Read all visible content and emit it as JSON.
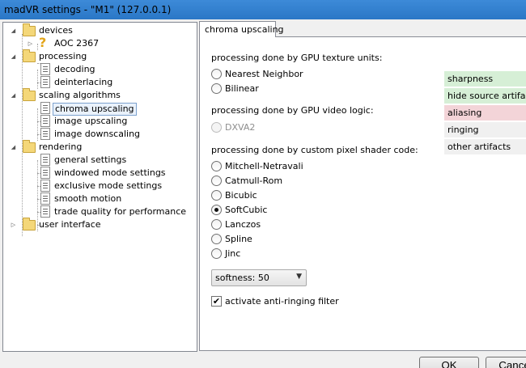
{
  "window": {
    "title": "madVR settings - \"M1\" (127.0.0.1)"
  },
  "tree": {
    "devices": "devices",
    "aoc": "AOC 2367",
    "processing": "processing",
    "decoding": "decoding",
    "deinterlacing": "deinterlacing",
    "scaling": "scaling algorithms",
    "chroma": "chroma upscaling",
    "image_up": "image upscaling",
    "image_down": "image downscaling",
    "rendering": "rendering",
    "general": "general settings",
    "windowed": "windowed mode settings",
    "exclusive": "exclusive mode settings",
    "smooth": "smooth motion",
    "trade": "trade quality for performance",
    "ui": "user interface"
  },
  "tab": {
    "label": "chroma upscaling"
  },
  "sections": {
    "texture": "processing done by GPU texture units:",
    "logic": "processing done by GPU video logic:",
    "shader": "processing done by custom pixel shader code:"
  },
  "radios": {
    "nearest": "Nearest Neighbor",
    "bilinear": "Bilinear",
    "dxva": "DXVA2",
    "mitchell": "Mitchell-Netravali",
    "catmull": "Catmull-Rom",
    "bicubic": "Bicubic",
    "softcubic": "SoftCubic",
    "lanczos": "Lanczos",
    "spline": "Spline",
    "jinc": "Jinc",
    "selected": "SoftCubic"
  },
  "softness": {
    "value": "softness: 50"
  },
  "antiringing": {
    "label": "activate anti-ringing filter",
    "checked": true
  },
  "legend": {
    "sharpness": "sharpness",
    "hide": "hide source artifacts",
    "aliasing": "aliasing",
    "ringing": "ringing",
    "other": "other artifacts",
    "colors": {
      "sharpness": "#d6efd6",
      "hide": "#d6efd6",
      "aliasing": "#f3d4d8",
      "ringing": "#f0f0f0",
      "other": "#f0f0f0"
    }
  },
  "buttons": {
    "ok": "OK",
    "cancel": "Cancel"
  }
}
